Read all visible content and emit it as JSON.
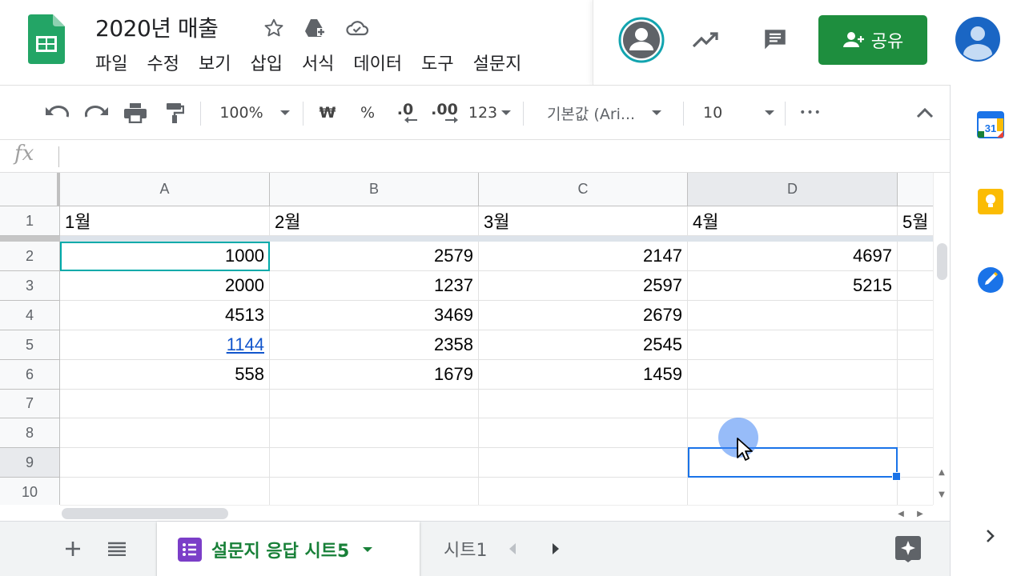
{
  "header": {
    "title": "2020년 매출",
    "menu": [
      "파일",
      "수정",
      "보기",
      "삽입",
      "서식",
      "데이터",
      "도구",
      "설문지"
    ],
    "share_label": "공유"
  },
  "toolbar": {
    "zoom": "100%",
    "currency": "₩",
    "percent": "%",
    "decrease_decimal": ".0",
    "increase_decimal": ".00",
    "number_format": "123",
    "font": "기본값 (Ari...",
    "font_size": "10",
    "more": "•••"
  },
  "formula_bar": {
    "label": "fx",
    "value": ""
  },
  "grid": {
    "columns": [
      "A",
      "B",
      "C",
      "D"
    ],
    "rows": [
      {
        "label": "1",
        "cells": [
          "1월",
          "2월",
          "3월",
          "4월",
          "5월"
        ]
      },
      {
        "label": "2",
        "cells": [
          "1000",
          "2579",
          "2147",
          "4697"
        ]
      },
      {
        "label": "3",
        "cells": [
          "2000",
          "1237",
          "2597",
          "5215"
        ]
      },
      {
        "label": "4",
        "cells": [
          "4513",
          "3469",
          "2679",
          ""
        ]
      },
      {
        "label": "5",
        "cells": [
          "1144",
          "2358",
          "2545",
          ""
        ]
      },
      {
        "label": "6",
        "cells": [
          "558",
          "1679",
          "1459",
          ""
        ]
      },
      {
        "label": "7",
        "cells": [
          "",
          "",
          "",
          ""
        ]
      },
      {
        "label": "8",
        "cells": [
          "",
          "",
          "",
          ""
        ]
      },
      {
        "label": "9",
        "cells": [
          "",
          "",
          "",
          ""
        ]
      },
      {
        "label": "10",
        "cells": [
          "",
          "",
          "",
          ""
        ]
      }
    ],
    "active_column": "D",
    "active_row": "9"
  },
  "sheets": {
    "active": "설문지 응답 시트5",
    "other": "시트1"
  },
  "colors": {
    "share_green": "#1e8e3e",
    "sheet_green": "#188038",
    "selection_blue": "#1a73e8",
    "link_blue": "#1155cc"
  }
}
